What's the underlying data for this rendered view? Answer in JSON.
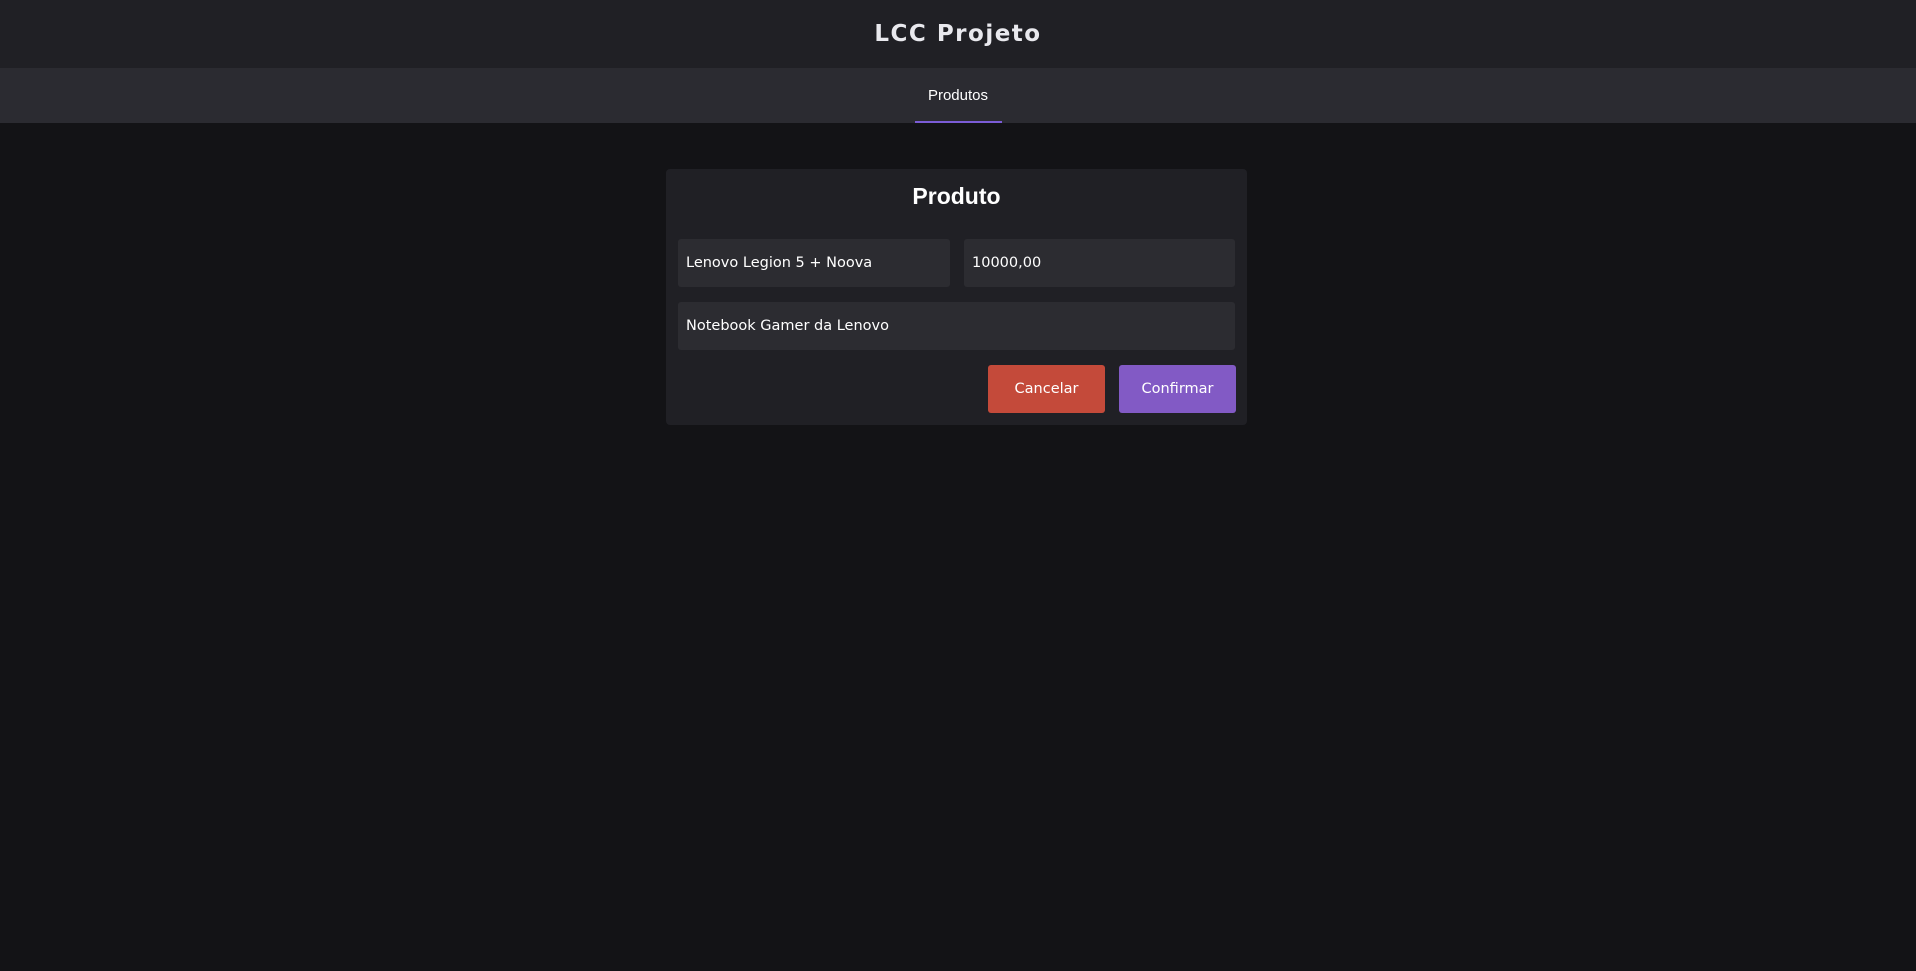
{
  "header": {
    "title": "LCC Projeto"
  },
  "nav": {
    "tabs": [
      {
        "label": "Produtos",
        "active": true
      }
    ]
  },
  "form": {
    "title": "Produto",
    "name_value": "Lenovo Legion 5 + Noova",
    "price_value": "10000,00",
    "description_value": "Notebook Gamer da Lenovo",
    "cancel_label": "Cancelar",
    "confirm_label": "Confirmar"
  },
  "colors": {
    "background": "#131316",
    "header": "#202025",
    "nav": "#2b2b31",
    "accent": "#7b5cd6",
    "cancel": "#c44a3a",
    "confirm": "#825ac5"
  }
}
